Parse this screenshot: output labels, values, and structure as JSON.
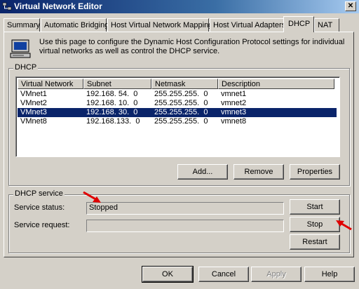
{
  "window": {
    "title": "Virtual Network Editor"
  },
  "tabs": [
    {
      "label": "Summary"
    },
    {
      "label": "Automatic Bridging"
    },
    {
      "label": "Host Virtual Network Mapping"
    },
    {
      "label": "Host Virtual Adapters"
    },
    {
      "label": "DHCP",
      "active": true
    },
    {
      "label": "NAT"
    }
  ],
  "page": {
    "description": "Use this page to configure the Dynamic Host Configuration Protocol settings for individual virtual networks as well as control the DHCP service."
  },
  "dhcp_group": {
    "label": "DHCP",
    "columns": [
      "Virtual Network",
      "Subnet",
      "Netmask",
      "Description"
    ],
    "rows": [
      {
        "network": "VMnet1",
        "subnet": "192.168. 54.  0",
        "netmask": "255.255.255.  0",
        "description": "vmnet1"
      },
      {
        "network": "VMnet2",
        "subnet": "192.168. 10.  0",
        "netmask": "255.255.255.  0",
        "description": "vmnet2"
      },
      {
        "network": "VMnet3",
        "subnet": "192.168. 30.  0",
        "netmask": "255.255.255.  0",
        "description": "vmnet3",
        "selected": true
      },
      {
        "network": "VMnet8",
        "subnet": "192.168.133.  0",
        "netmask": "255.255.255.  0",
        "description": "vmnet8"
      }
    ],
    "add_label": "Add...",
    "remove_label": "Remove",
    "properties_label": "Properties"
  },
  "service_group": {
    "label": "DHCP service",
    "status_label": "Service status:",
    "status_value": "Stopped",
    "request_label": "Service request:",
    "request_value": "",
    "start_label": "Start",
    "stop_label": "Stop",
    "restart_label": "Restart"
  },
  "footer": {
    "ok_label": "OK",
    "cancel_label": "Cancel",
    "apply_label": "Apply",
    "help_label": "Help"
  },
  "colors": {
    "selection": "#0a246a",
    "annotation_arrow": "#e00000",
    "titlebar": "#0a246a"
  }
}
